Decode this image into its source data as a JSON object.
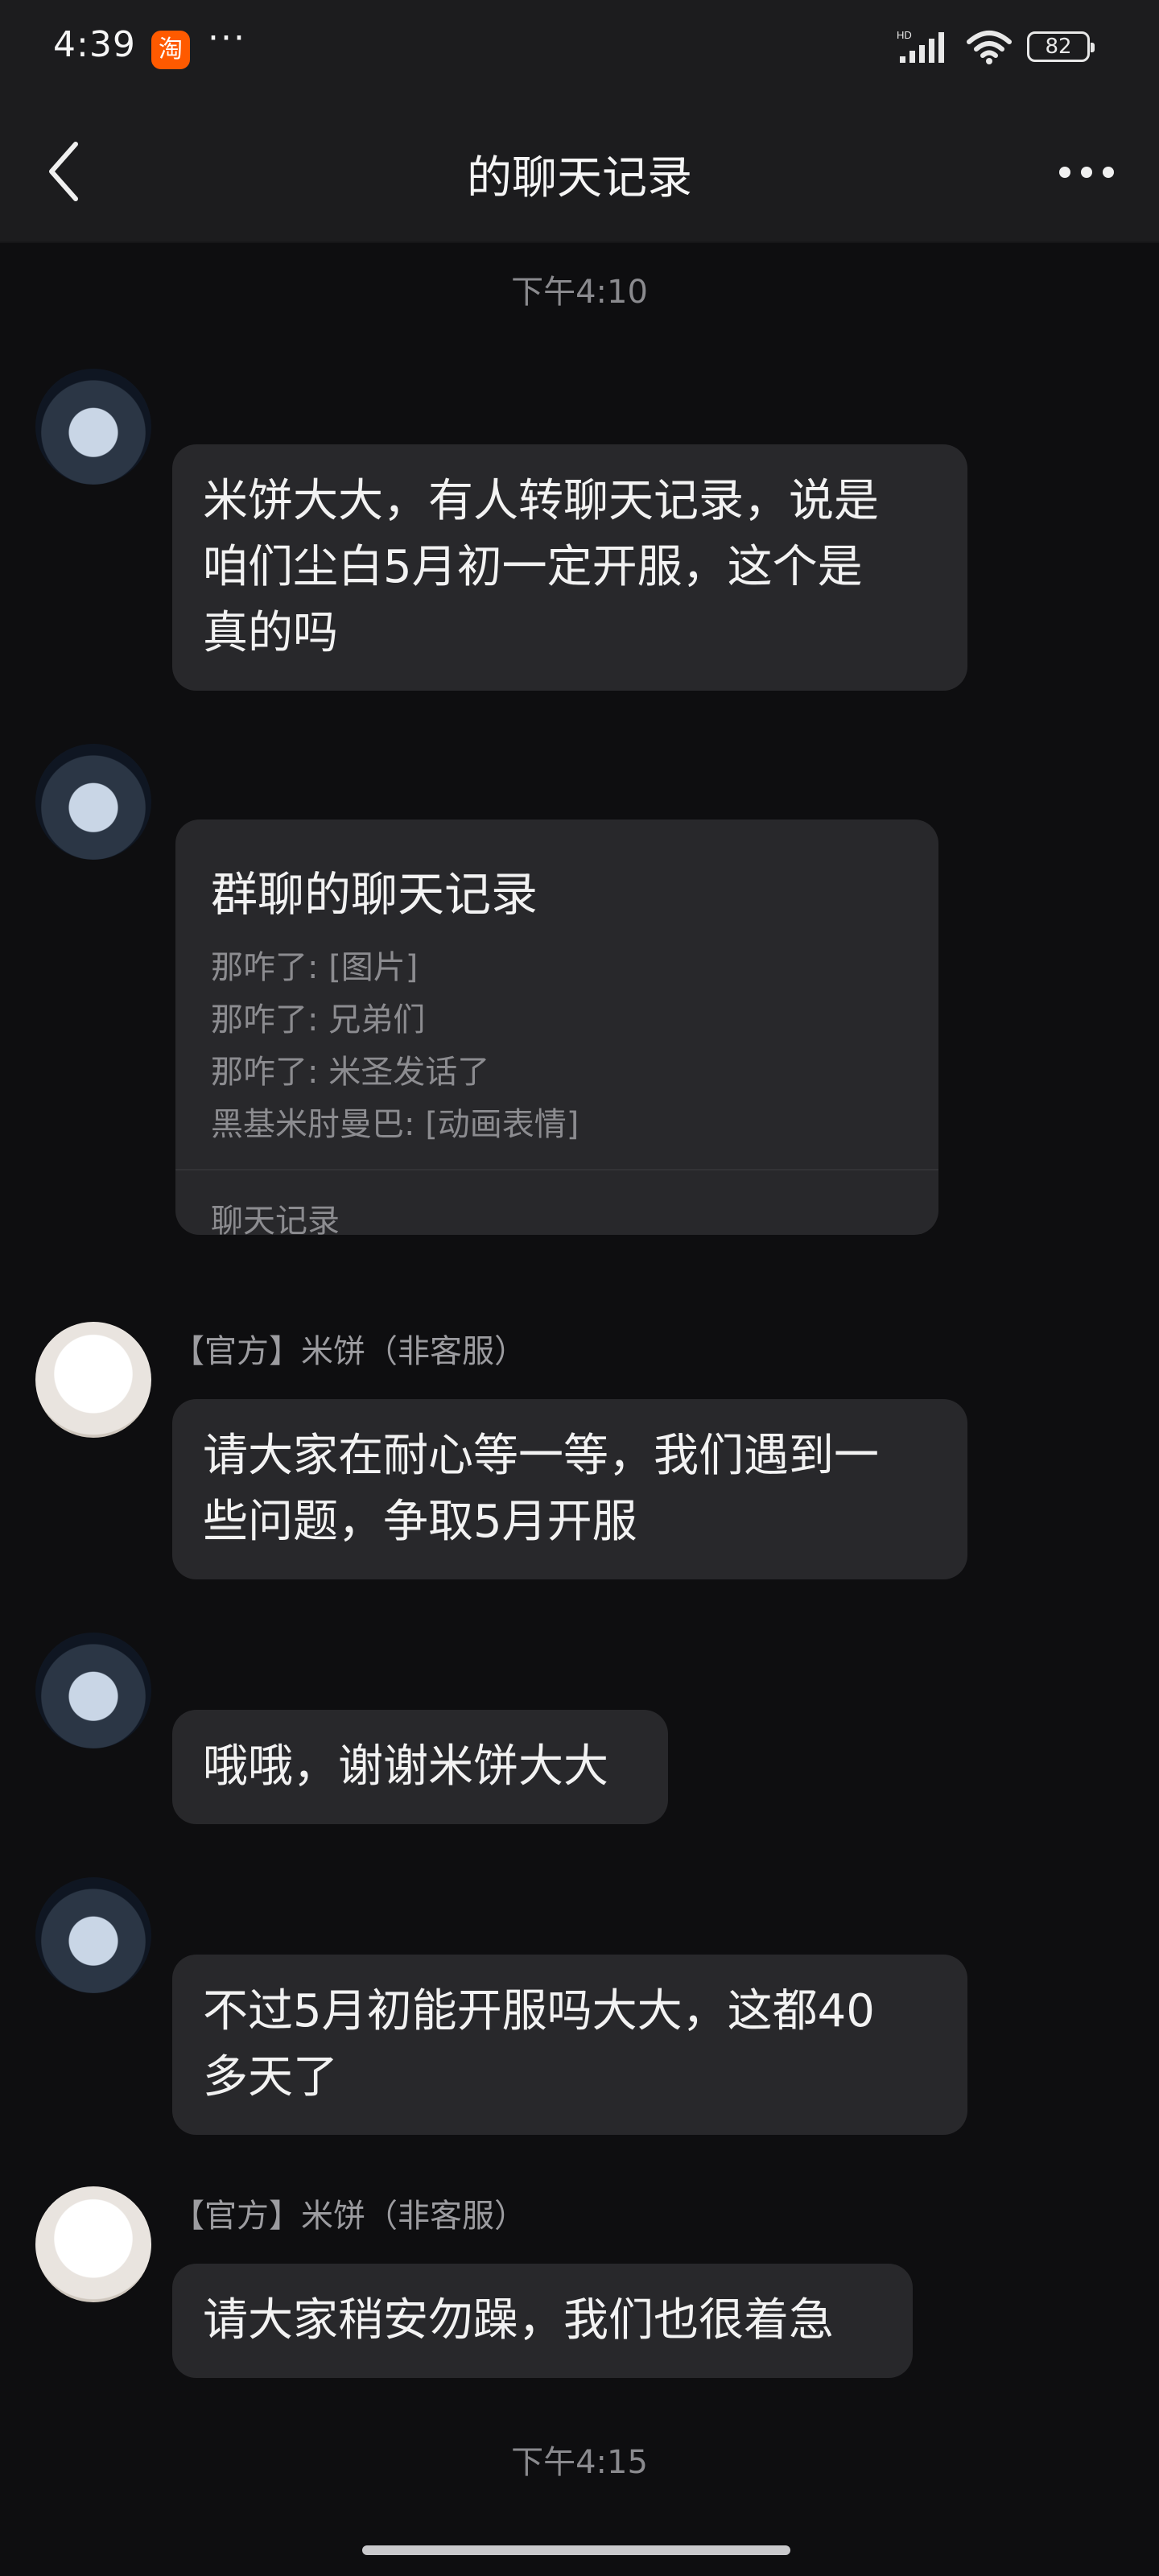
{
  "status_bar": {
    "time": "4:39",
    "app_icon_glyph": "淘",
    "more_dots": "···",
    "network_label": "HD",
    "battery": "82"
  },
  "header": {
    "title": "的聊天记录"
  },
  "timestamps": [
    "下午4:10",
    "下午4:15"
  ],
  "messages": [
    {
      "avatar": "anime-avatar",
      "text_lines": [
        "米饼大大，有人转聊天记录，说是",
        "咱们尘白5月初一定开服，这个是",
        "真的吗"
      ]
    },
    {
      "avatar": "anime-avatar",
      "card": {
        "title": "群聊的聊天记录",
        "lines": [
          "那咋了: [图片]",
          "那咋了: 兄弟们",
          "那咋了: 米圣发话了",
          "黑基米肘曼巴: [动画表情]"
        ],
        "footer": "聊天记录"
      }
    },
    {
      "avatar": "dog-avatar",
      "sender": "【官方】米饼（非客服）",
      "text_lines": [
        "请大家在耐心等一等，我们遇到一",
        "些问题，争取5月开服"
      ]
    },
    {
      "avatar": "anime-avatar",
      "text_lines": [
        "哦哦，谢谢米饼大大"
      ]
    },
    {
      "avatar": "anime-avatar",
      "text_lines": [
        "不过5月初能开服吗大大，这都40",
        "多天了"
      ]
    },
    {
      "avatar": "dog-avatar",
      "sender": "【官方】米饼（非客服）",
      "text_lines": [
        "请大家稍安勿躁，我们也很着急"
      ]
    }
  ],
  "colors": {
    "background": "#0e0e10",
    "bar": "#1c1c1e",
    "bubble": "#28282b",
    "secondary_text": "#8a8a8e"
  }
}
